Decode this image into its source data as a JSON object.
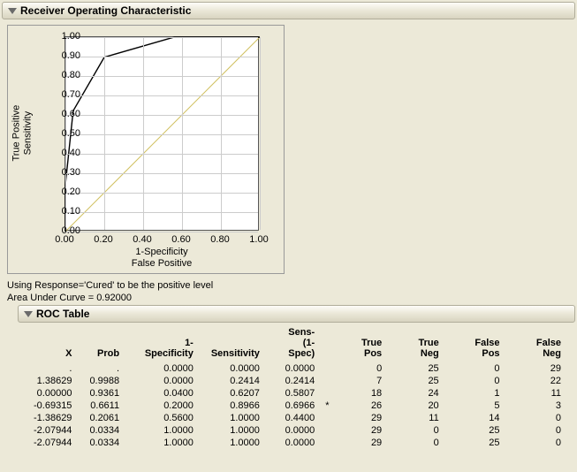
{
  "header": {
    "title": "Receiver Operating Characteristic"
  },
  "chart_data": {
    "type": "line",
    "title": "",
    "xlabel_top": "1-Specificity",
    "xlabel_bottom": "False Positive",
    "ylabel_top": "True Positive",
    "ylabel_bottom": "Sensitivity",
    "xlim": [
      0,
      1
    ],
    "ylim": [
      0,
      1
    ],
    "xticks": [
      0.0,
      0.2,
      0.4,
      0.6,
      0.8,
      1.0
    ],
    "yticks": [
      0.0,
      0.1,
      0.2,
      0.3,
      0.4,
      0.5,
      0.6,
      0.7,
      0.8,
      0.9,
      1.0
    ],
    "series": [
      {
        "name": "ROC",
        "color": "#000000",
        "x": [
          0.0,
          0.0,
          0.04,
          0.2,
          0.56,
          1.0,
          1.0
        ],
        "y": [
          0.0,
          0.2414,
          0.6207,
          0.8966,
          1.0,
          1.0,
          1.0
        ]
      },
      {
        "name": "Reference",
        "color": "#d0c060",
        "x": [
          0.0,
          1.0
        ],
        "y": [
          0.0,
          1.0
        ]
      }
    ]
  },
  "notes": {
    "response_line": "Using Response='Cured' to be the positive level",
    "auc_label": "Area Under Curve = ",
    "auc_value": "0.92000"
  },
  "roc_table": {
    "title": "ROC Table",
    "columns": [
      "X",
      "Prob",
      "1-Specificity",
      "Sensitivity",
      "Sens-\n(1-Spec)",
      "",
      "True Pos",
      "True Neg",
      "False Pos",
      "False Neg"
    ],
    "rows": [
      {
        "X": ".",
        "Prob": ".",
        "OneMinusSpec": "0.0000",
        "Sens": "0.0000",
        "Diff": "0.0000",
        "Star": "",
        "TP": "0",
        "TN": "25",
        "FP": "0",
        "FN": "29"
      },
      {
        "X": "1.38629",
        "Prob": "0.9988",
        "OneMinusSpec": "0.0000",
        "Sens": "0.2414",
        "Diff": "0.2414",
        "Star": "",
        "TP": "7",
        "TN": "25",
        "FP": "0",
        "FN": "22"
      },
      {
        "X": "0.00000",
        "Prob": "0.9361",
        "OneMinusSpec": "0.0400",
        "Sens": "0.6207",
        "Diff": "0.5807",
        "Star": "",
        "TP": "18",
        "TN": "24",
        "FP": "1",
        "FN": "11"
      },
      {
        "X": "-0.69315",
        "Prob": "0.6611",
        "OneMinusSpec": "0.2000",
        "Sens": "0.8966",
        "Diff": "0.6966",
        "Star": "*",
        "TP": "26",
        "TN": "20",
        "FP": "5",
        "FN": "3"
      },
      {
        "X": "-1.38629",
        "Prob": "0.2061",
        "OneMinusSpec": "0.5600",
        "Sens": "1.0000",
        "Diff": "0.4400",
        "Star": "",
        "TP": "29",
        "TN": "11",
        "FP": "14",
        "FN": "0"
      },
      {
        "X": "-2.07944",
        "Prob": "0.0334",
        "OneMinusSpec": "1.0000",
        "Sens": "1.0000",
        "Diff": "0.0000",
        "Star": "",
        "TP": "29",
        "TN": "0",
        "FP": "25",
        "FN": "0"
      },
      {
        "X": "-2.07944",
        "Prob": "0.0334",
        "OneMinusSpec": "1.0000",
        "Sens": "1.0000",
        "Diff": "0.0000",
        "Star": "",
        "TP": "29",
        "TN": "0",
        "FP": "25",
        "FN": "0"
      }
    ]
  }
}
